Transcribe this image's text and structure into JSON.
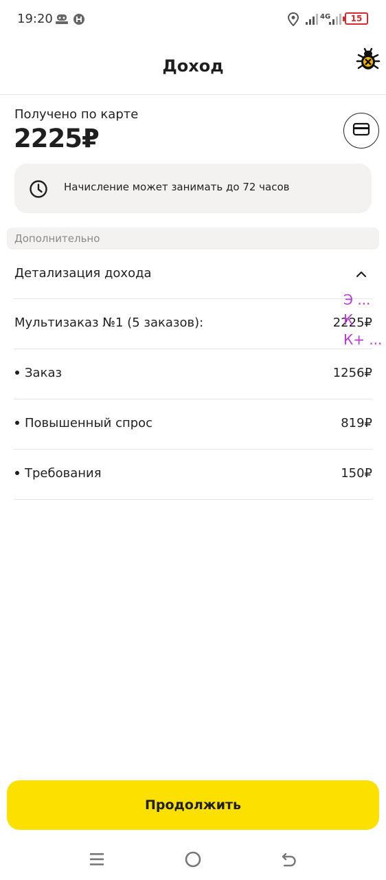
{
  "status_bar": {
    "time": "19:20",
    "battery": "15",
    "network": "4G",
    "icons": [
      "app-notification-icon",
      "app-notification-icon",
      "location-icon",
      "signal-icon",
      "signal-icon",
      "battery-icon"
    ]
  },
  "header": {
    "title": "Доход",
    "debug_icon": "bug-icon"
  },
  "summary": {
    "label": "Получено по карте",
    "amount": "2225₽",
    "card_icon": "card-icon"
  },
  "notice": {
    "icon": "clock-icon",
    "text": "Начисление может занимать до 72 часов"
  },
  "section": {
    "label": "Дополнительно"
  },
  "details": {
    "label": "Детализация дохода",
    "expanded": true,
    "multiorder": {
      "label": "Мультизаказ №1 (5 заказов):",
      "value": "2225₽"
    },
    "items": [
      {
        "label": "Заказ",
        "value": "1256₽"
      },
      {
        "label": "Повышенный спрос",
        "value": "819₽"
      },
      {
        "label": "Требования",
        "value": "150₽"
      }
    ]
  },
  "overlay": {
    "lines": [
      "Э ...",
      "К",
      "К+ ..."
    ],
    "color": "#b83ad6"
  },
  "actions": {
    "continue_label": "Продолжить",
    "accent": "#fce000"
  },
  "nav_bar": {
    "icons": [
      "menu-icon",
      "home-icon",
      "back-icon"
    ]
  }
}
